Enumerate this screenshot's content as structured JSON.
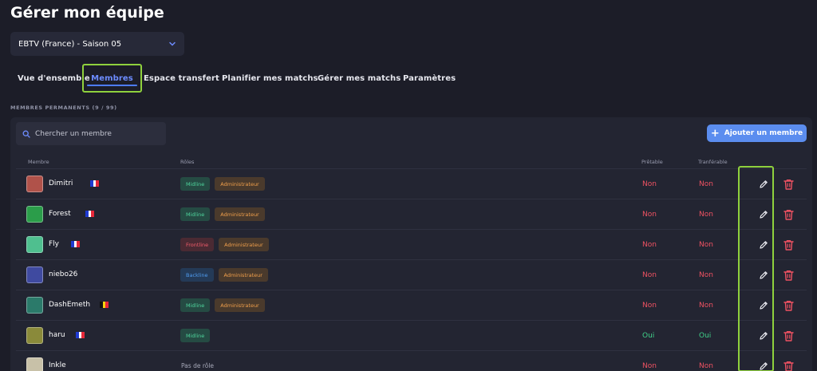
{
  "page": {
    "title": "Gérer mon équipe"
  },
  "season": {
    "selected": "EBTV (France) - Saison 05"
  },
  "tabs": [
    {
      "label": "Vue d'ensemble"
    },
    {
      "label": "Membres"
    },
    {
      "label": "Espace transfert"
    },
    {
      "label": "Planifier mes matchs"
    },
    {
      "label": "Gérer mes matchs"
    },
    {
      "label": "Paramètres"
    }
  ],
  "members": {
    "section_title": "MEMBRES PERMANENTS (9 / 99)",
    "search_placeholder": "Chercher un membre",
    "add_button": "Ajouter un membre",
    "columns": {
      "member": "Membre",
      "roles": "Rôles",
      "loanable": "Prêtable",
      "transferable": "Tranférable"
    },
    "no_role_text": "Pas de rôle",
    "rows": [
      {
        "name": "Dimitri",
        "flag": "fr",
        "roles": [
          "Midline",
          "Administrateur"
        ],
        "loanable": "Non",
        "transferable": "Non"
      },
      {
        "name": "Forest",
        "flag": "fr",
        "roles": [
          "Midline",
          "Administrateur"
        ],
        "loanable": "Non",
        "transferable": "Non"
      },
      {
        "name": "Fly",
        "flag": "fr",
        "roles": [
          "Frontline",
          "Administrateur"
        ],
        "loanable": "Non",
        "transferable": "Non"
      },
      {
        "name": "niebo26",
        "flag": "",
        "roles": [
          "Backline",
          "Administrateur"
        ],
        "loanable": "Non",
        "transferable": "Non"
      },
      {
        "name": "DashEmeth",
        "flag": "be",
        "roles": [
          "Midline",
          "Administrateur"
        ],
        "loanable": "Non",
        "transferable": "Non"
      },
      {
        "name": "haru",
        "flag": "fr",
        "roles": [
          "Midline"
        ],
        "loanable": "Oui",
        "transferable": "Oui"
      },
      {
        "name": "Inkle",
        "flag": "",
        "roles": [],
        "loanable": "Non",
        "transferable": "Non"
      }
    ]
  },
  "colors": {
    "background": "#1c1d28",
    "accent": "#5b8def",
    "highlight": "#8fd13d",
    "negative": "#f05262",
    "positive": "#40d18a"
  }
}
